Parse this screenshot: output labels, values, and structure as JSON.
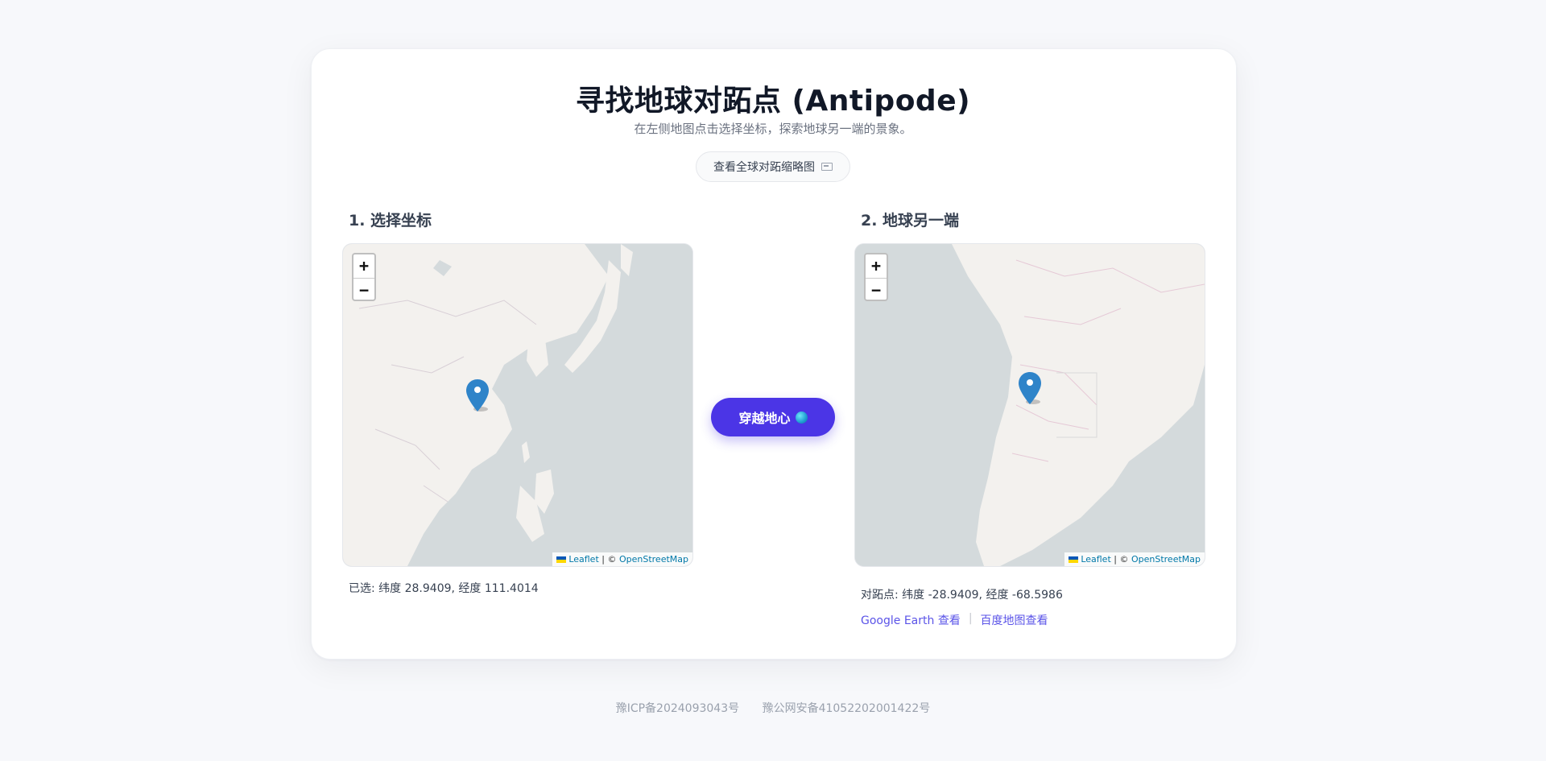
{
  "header": {
    "title": "寻找地球对跖点 (Antipode)",
    "subtitle": "在左侧地图点击选择坐标，探索地球另一端的景象。",
    "view_button_label": "查看全球对跖缩略图"
  },
  "left_panel": {
    "section_title": "1. 选择坐标",
    "zoom_in": "+",
    "zoom_out": "−",
    "attribution_leaflet": "Leaflet",
    "attribution_sep": " | © ",
    "attribution_osm": "OpenStreetMap",
    "selected_text": "已选: 纬度 28.9409, 经度 111.4014"
  },
  "center": {
    "go_button_label": "穿越地心"
  },
  "right_panel": {
    "section_title": "2. 地球另一端",
    "zoom_in": "+",
    "zoom_out": "−",
    "attribution_leaflet": "Leaflet",
    "attribution_sep": " | © ",
    "attribution_osm": "OpenStreetMap",
    "antipode_text": "对跖点: 纬度 -28.9409, 经度 -68.5986",
    "link_google": "Google Earth 查看",
    "link_sep": "|",
    "link_baidu": "百度地图查看"
  },
  "footer": {
    "icp": "豫ICP备2024093043号",
    "police": "豫公网安备41052202001422号"
  },
  "colors": {
    "accent": "#4b35e6",
    "link": "#5b54e8",
    "marker": "#2f84c9"
  },
  "icons": {
    "globe": "globe-icon",
    "marker": "map-marker-icon",
    "view_map": "map-icon"
  }
}
